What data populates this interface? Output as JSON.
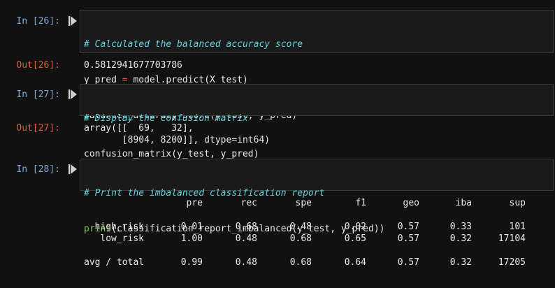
{
  "cells": [
    {
      "in_prompt": "In [26]:",
      "code_lines": [
        {
          "parts": [
            {
              "cls": "comment",
              "text": "# Calculated the balanced accuracy score"
            }
          ]
        },
        {
          "parts": [
            {
              "cls": "",
              "text": "y_pred "
            },
            {
              "cls": "op",
              "text": "="
            },
            {
              "cls": "",
              "text": " model.predict(X_test)"
            }
          ]
        },
        {
          "parts": [
            {
              "cls": "",
              "text": "balanced_accuracy_score(y_test, y_pred)"
            }
          ]
        }
      ],
      "out_prompt": "Out[26]:",
      "output": "0.5812941677703786"
    },
    {
      "in_prompt": "In [27]:",
      "code_lines": [
        {
          "parts": [
            {
              "cls": "comment",
              "text": "# Display the confusion matrix"
            }
          ]
        },
        {
          "parts": [
            {
              "cls": "",
              "text": "confusion_matrix(y_test, y_pred)"
            }
          ]
        }
      ],
      "out_prompt": "Out[27]:",
      "output": "array([[  69,   32],\n       [8904, 8200]], dtype=int64)"
    },
    {
      "in_prompt": "In [28]:",
      "code_lines": [
        {
          "parts": [
            {
              "cls": "comment",
              "text": "# Print the imbalanced classification report"
            }
          ]
        },
        {
          "parts": [
            {
              "cls": "builtin",
              "text": "print"
            },
            {
              "cls": "",
              "text": "(classification_report_imbalanced(y_test, y_pred))"
            }
          ]
        }
      ]
    }
  ],
  "report": {
    "headers": [
      "pre",
      "rec",
      "spe",
      "f1",
      "geo",
      "iba",
      "sup"
    ],
    "rows": [
      {
        "label": "high_risk",
        "values": [
          "0.01",
          "0.68",
          "0.48",
          "0.02",
          "0.57",
          "0.33",
          "101"
        ]
      },
      {
        "label": "low_risk",
        "values": [
          "1.00",
          "0.48",
          "0.68",
          "0.65",
          "0.57",
          "0.32",
          "17104"
        ]
      },
      {
        "label": "avg / total",
        "values": [
          "0.99",
          "0.48",
          "0.68",
          "0.64",
          "0.57",
          "0.32",
          "17205"
        ]
      }
    ]
  },
  "icons": {
    "run": "run-cell-icon"
  }
}
